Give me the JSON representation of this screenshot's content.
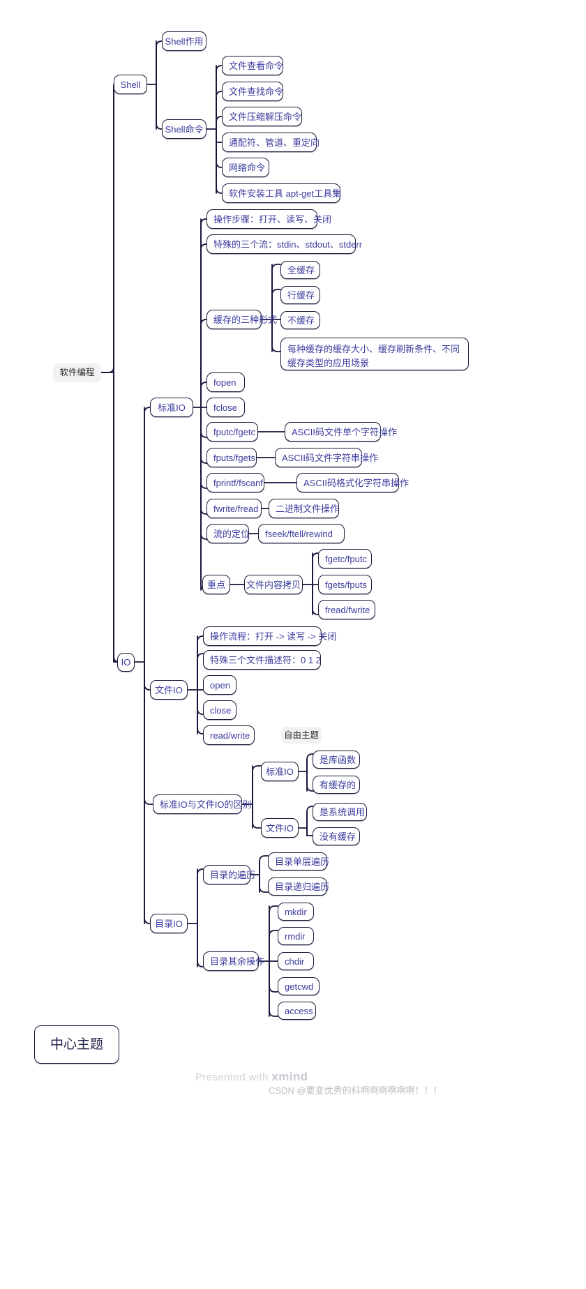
{
  "app": {
    "title": "软件编程 思维导图",
    "watermark_text": "Presented with ",
    "watermark_brand": "xmind",
    "csdn_watermark": "CSDN @要变优秀的科啊啊啊啊啊啊！！！"
  },
  "colors": {
    "node_border": "#1b1b3a",
    "node_text": "#3b3b9e",
    "edge": "#14143a",
    "root_bg": "#f2f2f5",
    "canvas_bg": "#ffffff"
  },
  "nodes": {
    "root": "软件编程",
    "shell": "Shell",
    "shell_role": "Shell作用",
    "shell_cmd": "Shell命令",
    "cmd_view": "文件查看命令",
    "cmd_find": "文件查找命令",
    "cmd_zip": "文件压缩解压命令",
    "cmd_wildcard": "通配符、管道、重定向",
    "cmd_net": "网络命令",
    "cmd_apt": "软件安装工具 apt-get工具集",
    "io": "IO",
    "stdio": "标准IO",
    "stdio_steps": "操作步骤：打开、读写、关闭",
    "stdio_streams": "特殊的三个流：stdin、stdout、stderr",
    "buffer_forms": "缓存的三种形式",
    "buf_full": "全缓存",
    "buf_line": "行缓存",
    "buf_none": "不缓存",
    "buf_detail": "每种缓存的缓存大小、缓存刷新条件、不同缓存类型的应用场景",
    "fopen": "fopen",
    "fclose": "fclose",
    "fputc_fgetc": "fputc/fgetc",
    "fputc_desc": "ASCII码文件单个字符操作",
    "fputs_fgets": "fputs/fgets",
    "fputs_desc": "ASCII码文件字符串操作",
    "fprintf_fscanf": "fprintf/fscanf",
    "fprintf_desc": "ASCII码格式化字符串操作",
    "fwrite_fread": "fwrite/fread",
    "fwrite_desc": "二进制文件操作",
    "stream_pos": "流的定位",
    "stream_pos_desc": "fseek/ftell/rewind",
    "keypoint": "重点",
    "file_copy": "文件内容拷贝",
    "copy_1": "fgetc/fputc",
    "copy_2": "fgets/fputs",
    "copy_3": "fread/fwrite",
    "fileio": "文件IO",
    "fileio_flow": "操作流程：打开 -> 读写 -> 关闭",
    "fileio_fd": "特殊三个文件描述符：0 1 2",
    "open": "open",
    "close": "close",
    "read_write": "read/write",
    "free_topic": "自由主题",
    "diff": "标准IO与文件IO的区别",
    "diff_stdio": "标准IO",
    "diff_stdio_1": "是库函数",
    "diff_stdio_2": "有缓存的",
    "diff_fileio": "文件IO",
    "diff_fileio_1": "是系统调用",
    "diff_fileio_2": "没有缓存",
    "dirio": "目录IO",
    "dir_traverse": "目录的遍历",
    "dir_single": "目录单层遍历",
    "dir_recursive": "目录递归遍历",
    "dir_other": "目录其余操作",
    "mkdir": "mkdir",
    "rmdir": "rmdir",
    "chdir": "chdir",
    "getcwd": "getcwd",
    "access": "access",
    "center_theme": "中心主题"
  }
}
